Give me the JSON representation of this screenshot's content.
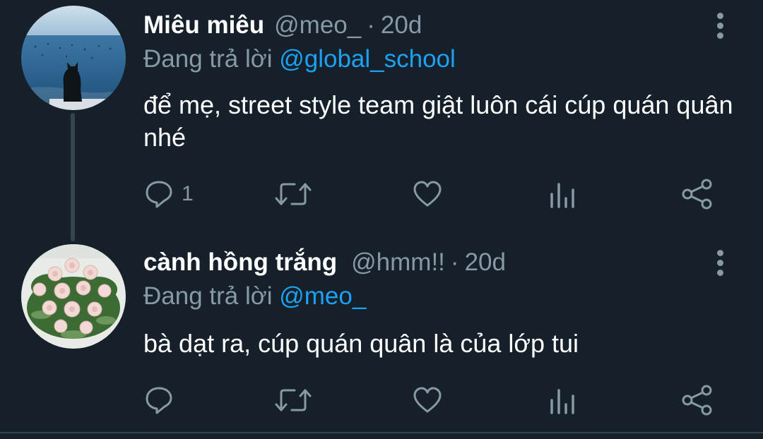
{
  "colors": {
    "background": "#15202b",
    "primary_text": "#ffffff",
    "secondary_text": "#8899a6",
    "mention": "#1da1f2",
    "divider": "#38444d"
  },
  "tweets": [
    {
      "author_name": "Miêu miêu",
      "handle": "@meo_",
      "separator": "·",
      "time": "20d",
      "reply_prefix": "Đang trả lời",
      "reply_mention": "@global_school",
      "body": "để mẹ, street style team giật luôn cái cúp quán quân nhé",
      "avatar": "cat-sitting-by-sea-avatar",
      "actions": {
        "reply": {
          "icon": "reply-icon",
          "count": "1"
        },
        "retweet": {
          "icon": "retweet-icon"
        },
        "like": {
          "icon": "heart-icon"
        },
        "analytics": {
          "icon": "analytics-icon"
        },
        "share": {
          "icon": "share-icon"
        }
      },
      "more_icon": "more-vertical-icon"
    },
    {
      "author_name": "cành hồng trắng",
      "handle": "@hmm!!",
      "separator": "·",
      "time": "20d",
      "reply_prefix": "Đang trả lời",
      "reply_mention": "@meo_",
      "body": "bà dạt ra, cúp quán quân là của lớp tui",
      "avatar": "white-roses-bouquet-avatar",
      "actions": {
        "reply": {
          "icon": "reply-icon",
          "count": ""
        },
        "retweet": {
          "icon": "retweet-icon"
        },
        "like": {
          "icon": "heart-icon"
        },
        "analytics": {
          "icon": "analytics-icon"
        },
        "share": {
          "icon": "share-icon"
        }
      },
      "more_icon": "more-vertical-icon"
    }
  ]
}
